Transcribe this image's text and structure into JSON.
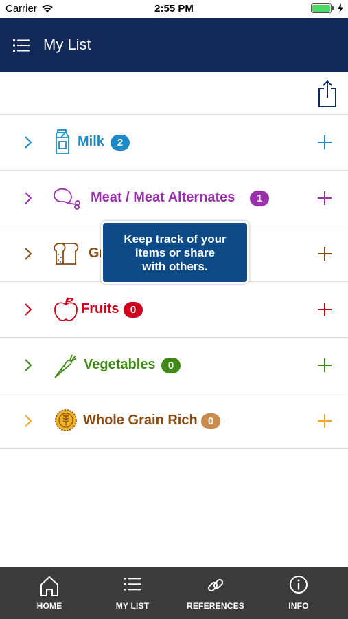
{
  "status_bar": {
    "carrier": "Carrier",
    "time": "2:55 PM"
  },
  "nav": {
    "title": "My List"
  },
  "list": [
    {
      "label": "Milk",
      "count": "2",
      "color": "#1a8bc8"
    },
    {
      "label": "Meat / Meat Alternates",
      "count": "1",
      "color": "#9b2fae"
    },
    {
      "label": "Gr",
      "count": "",
      "color": "#8a4b12"
    },
    {
      "label": "Fruits",
      "count": "0",
      "color": "#d0021b"
    },
    {
      "label": "Vegetables",
      "count": "0",
      "color": "#3f8a16"
    },
    {
      "label": "Whole Grain Rich",
      "count": "0",
      "color": "#8a4b12"
    }
  ],
  "tooltip": {
    "line1": "Keep track of your",
    "line2": "items or share",
    "line3": "with others."
  },
  "tabs": [
    {
      "label": "HOME",
      "icon": "home-icon"
    },
    {
      "label": "MY LIST",
      "icon": "list-icon"
    },
    {
      "label": "REFERENCES",
      "icon": "link-icon"
    },
    {
      "label": "INFO",
      "icon": "info-icon"
    }
  ],
  "colors": {
    "nav_bg": "#12295a",
    "tooltip_bg": "#0d4a86",
    "tab_bar_bg": "#3b3b3b",
    "whole_grain_plus": "#f5a623"
  }
}
